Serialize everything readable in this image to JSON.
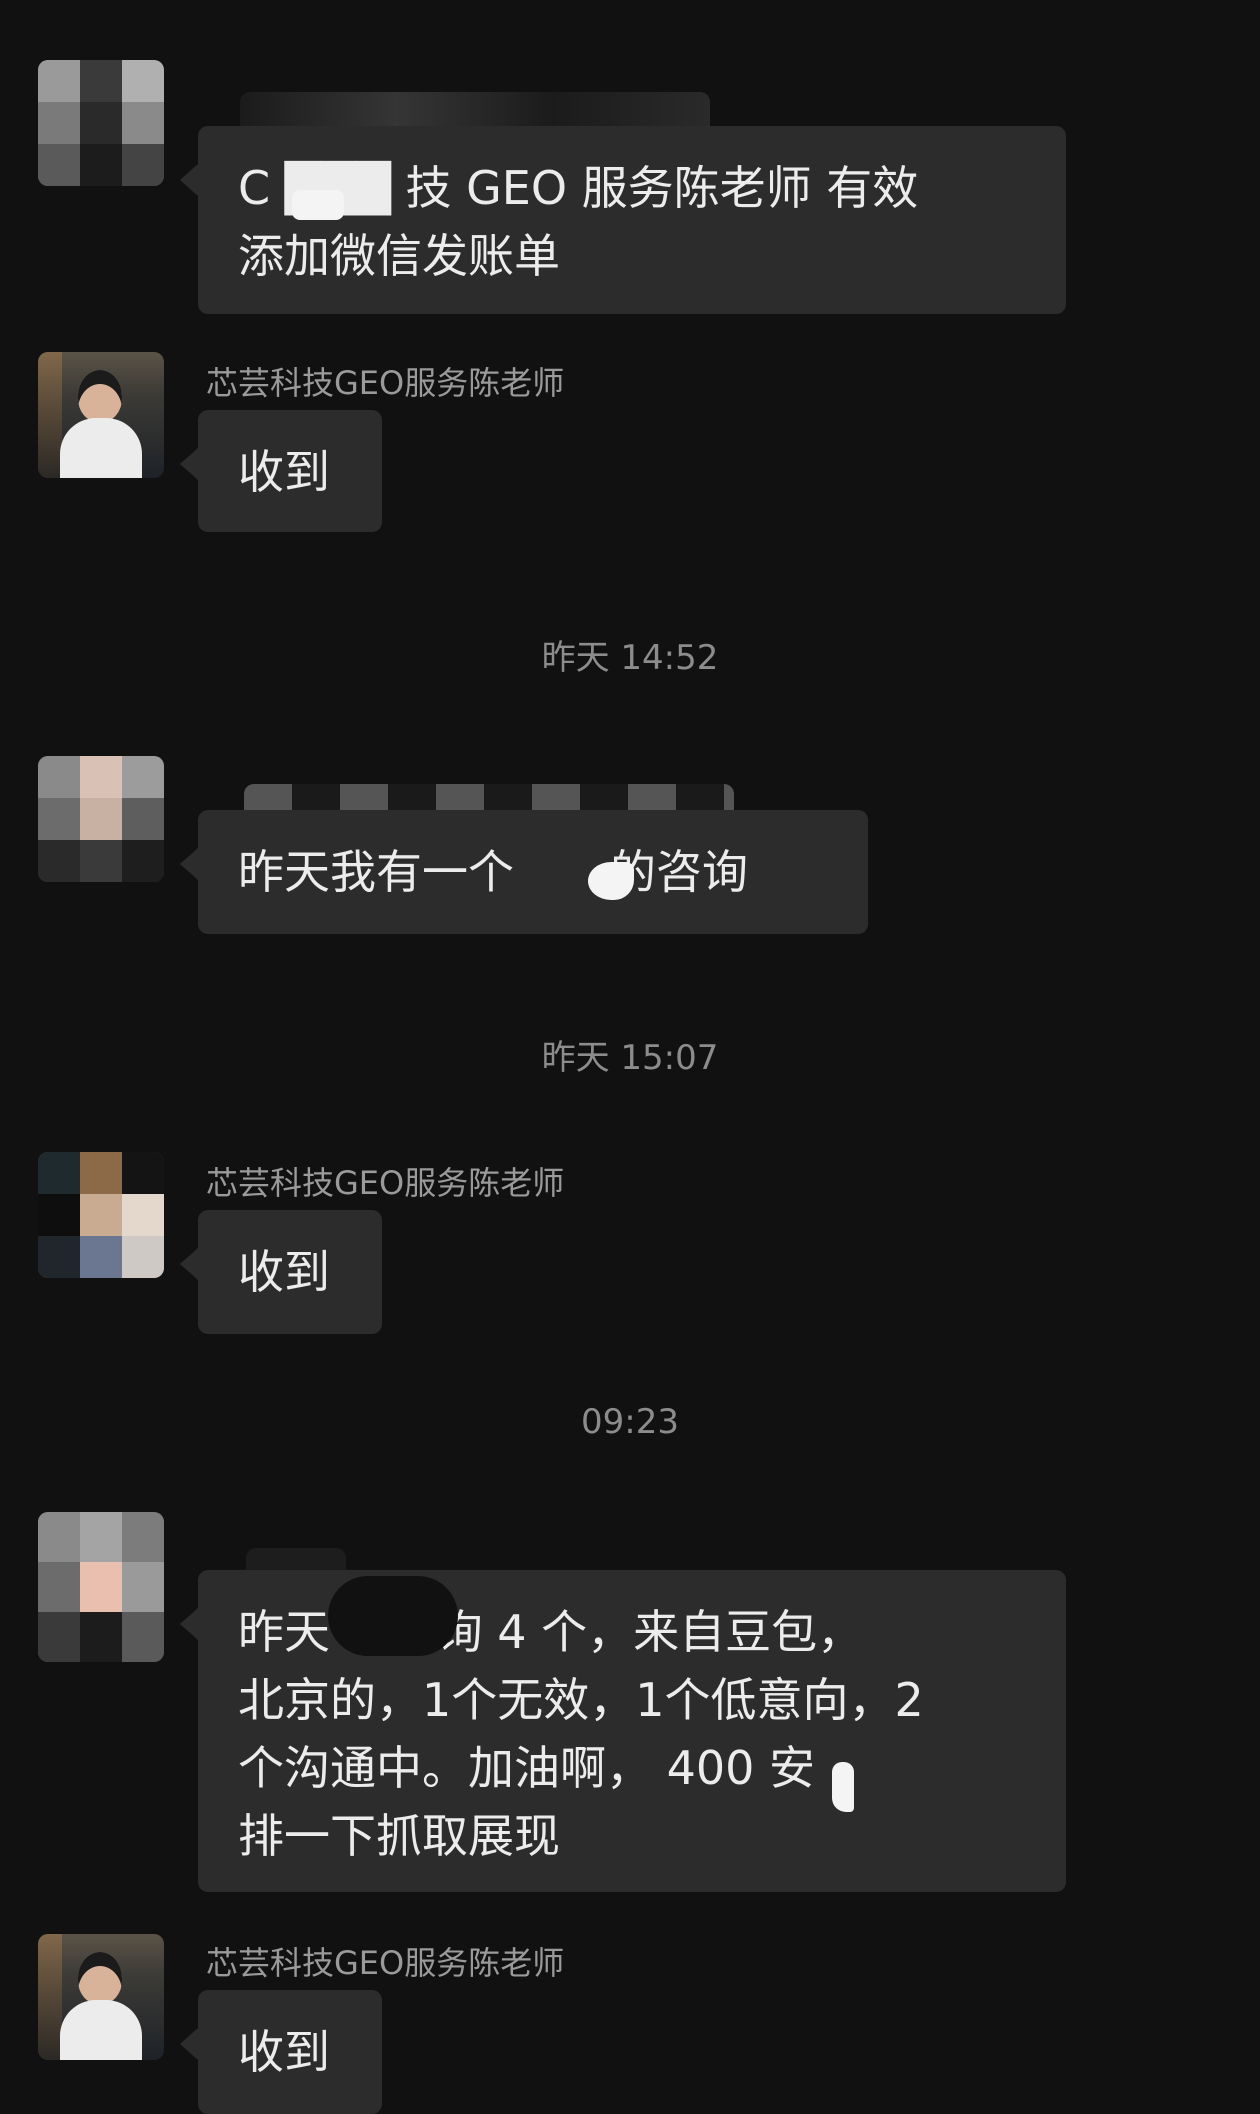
{
  "chat": {
    "messages": [
      {
        "sender": "",
        "text_line1": "C ███ 技 GEO 服务陈老师  有效",
        "text_line2": "添加微信发账单"
      },
      {
        "sender": "芯芸科技GEO服务陈老师",
        "text": "收到"
      },
      {
        "time": "昨天 14:52"
      },
      {
        "sender": "",
        "text": "昨天我有一个",
        "text_tail": "的咨询"
      },
      {
        "time": "昨天 15:07"
      },
      {
        "sender": "芯芸科技GEO服务陈老师",
        "text": "收到"
      },
      {
        "time": "09:23"
      },
      {
        "sender": "",
        "lines": [
          "昨天            的咨询 4 个，来自豆包，",
          "北京的，1个无效，1个低意向，2",
          "个沟通中。加油啊，           400 安",
          "排一下抓取展现"
        ]
      },
      {
        "sender": "芯芸科技GEO服务陈老师",
        "text": "收到"
      }
    ]
  },
  "colors": {
    "background": "#111111",
    "bubble": "#2c2c2c",
    "sender_text": "#9a9a9a",
    "timestamp": "#8c8c8c",
    "message_text": "#ececec"
  }
}
